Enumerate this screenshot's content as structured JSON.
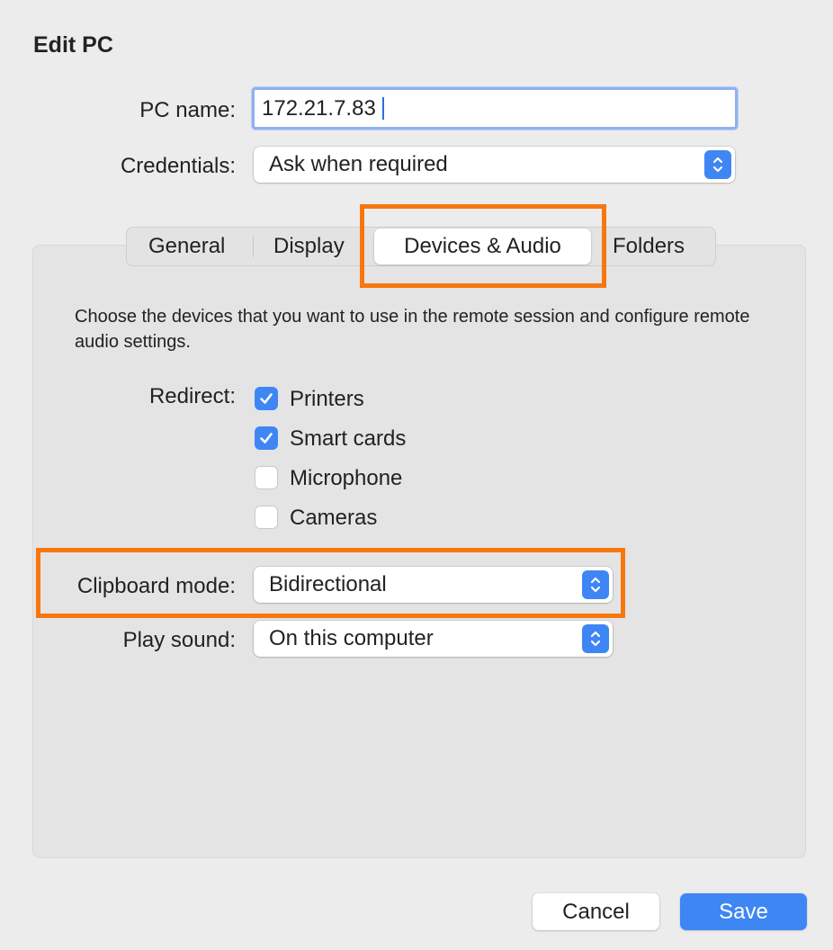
{
  "window": {
    "title": "Edit PC"
  },
  "pc_name": {
    "label": "PC name:",
    "value": "172.21.7.83"
  },
  "credentials": {
    "label": "Credentials:",
    "value": "Ask when required"
  },
  "tabs": [
    {
      "label": "General",
      "selected": false
    },
    {
      "label": "Display",
      "selected": false
    },
    {
      "label": "Devices & Audio",
      "selected": true
    },
    {
      "label": "Folders",
      "selected": false
    }
  ],
  "description": "Choose the devices that you want to use in the remote session and configure remote audio settings.",
  "redirect": {
    "label": "Redirect:",
    "options": [
      {
        "label": "Printers",
        "checked": true
      },
      {
        "label": "Smart cards",
        "checked": true
      },
      {
        "label": "Microphone",
        "checked": false
      },
      {
        "label": "Cameras",
        "checked": false
      }
    ]
  },
  "clipboard_mode": {
    "label": "Clipboard mode:",
    "value": "Bidirectional"
  },
  "play_sound": {
    "label": "Play sound:",
    "value": "On this computer"
  },
  "buttons": {
    "cancel": "Cancel",
    "save": "Save"
  },
  "colors": {
    "accent": "#3f86f5",
    "highlight": "#f7770f",
    "background": "#ececec"
  },
  "icons": {
    "checkmark": "checkmark-icon",
    "stepper": "updown-chevron-icon"
  }
}
